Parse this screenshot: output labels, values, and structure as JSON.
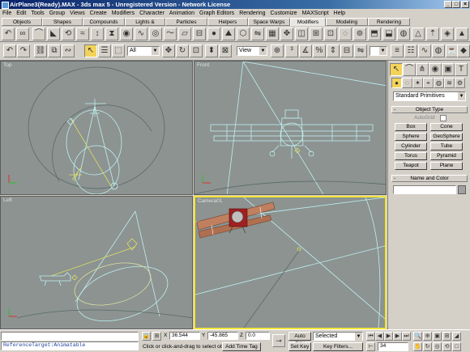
{
  "window": {
    "title": "AirPlane3(Ready).MAX - 3ds max 5 - Unregistered Version - Network License",
    "minimize": "_",
    "maximize": "□",
    "close": "×"
  },
  "menu": [
    "File",
    "Edit",
    "Tools",
    "Group",
    "Views",
    "Create",
    "Modifiers",
    "Character",
    "Animation",
    "Graph Editors",
    "Rendering",
    "Customize",
    "MAXScript",
    "Help"
  ],
  "tabs": [
    "Objects",
    "Shapes",
    "Compounds",
    "Lights & Cameras",
    "Particles",
    "Helpers",
    "Space Warps",
    "Modifiers",
    "Modeling",
    "Rendering"
  ],
  "active_tab": "Modifiers",
  "maintoolbar": {
    "selection_filter": "All",
    "reference_coord": "View"
  },
  "viewports": {
    "top": "Top",
    "front": "Front",
    "left": "Left",
    "camera": "Camera01"
  },
  "command_panel": {
    "primitive_type": "Standard Primitives",
    "object_type_title": "Object Type",
    "autogrid": "AutoGrid",
    "buttons": [
      "Box",
      "Cone",
      "Sphere",
      "GeoSphere",
      "Cylinder",
      "Tube",
      "Torus",
      "Pyramid",
      "Teapot",
      "Plane"
    ],
    "name_color_title": "Name and Color",
    "name_value": ""
  },
  "status": {
    "maxscript_line1": "",
    "maxscript_line2": "ReferenceTarget:Animatable",
    "x_label": "X",
    "x_value": "36.544",
    "y_label": "Y",
    "y_value": "-45.865",
    "z_label": "Z",
    "z_value": "0.0",
    "prompt": "Click or click-and-drag to select obj",
    "add_time_tag": "Add Time Tag",
    "auto_key": "Auto Key",
    "set_key": "Set Key",
    "key_mode": "Selected",
    "key_filters": "Key Filters...",
    "frame": "34"
  },
  "colors": {
    "viewport_bg": "#8c9391",
    "wire": "#bff0f0",
    "active_border": "#f5e43a",
    "title_bar": "#0a246a"
  }
}
